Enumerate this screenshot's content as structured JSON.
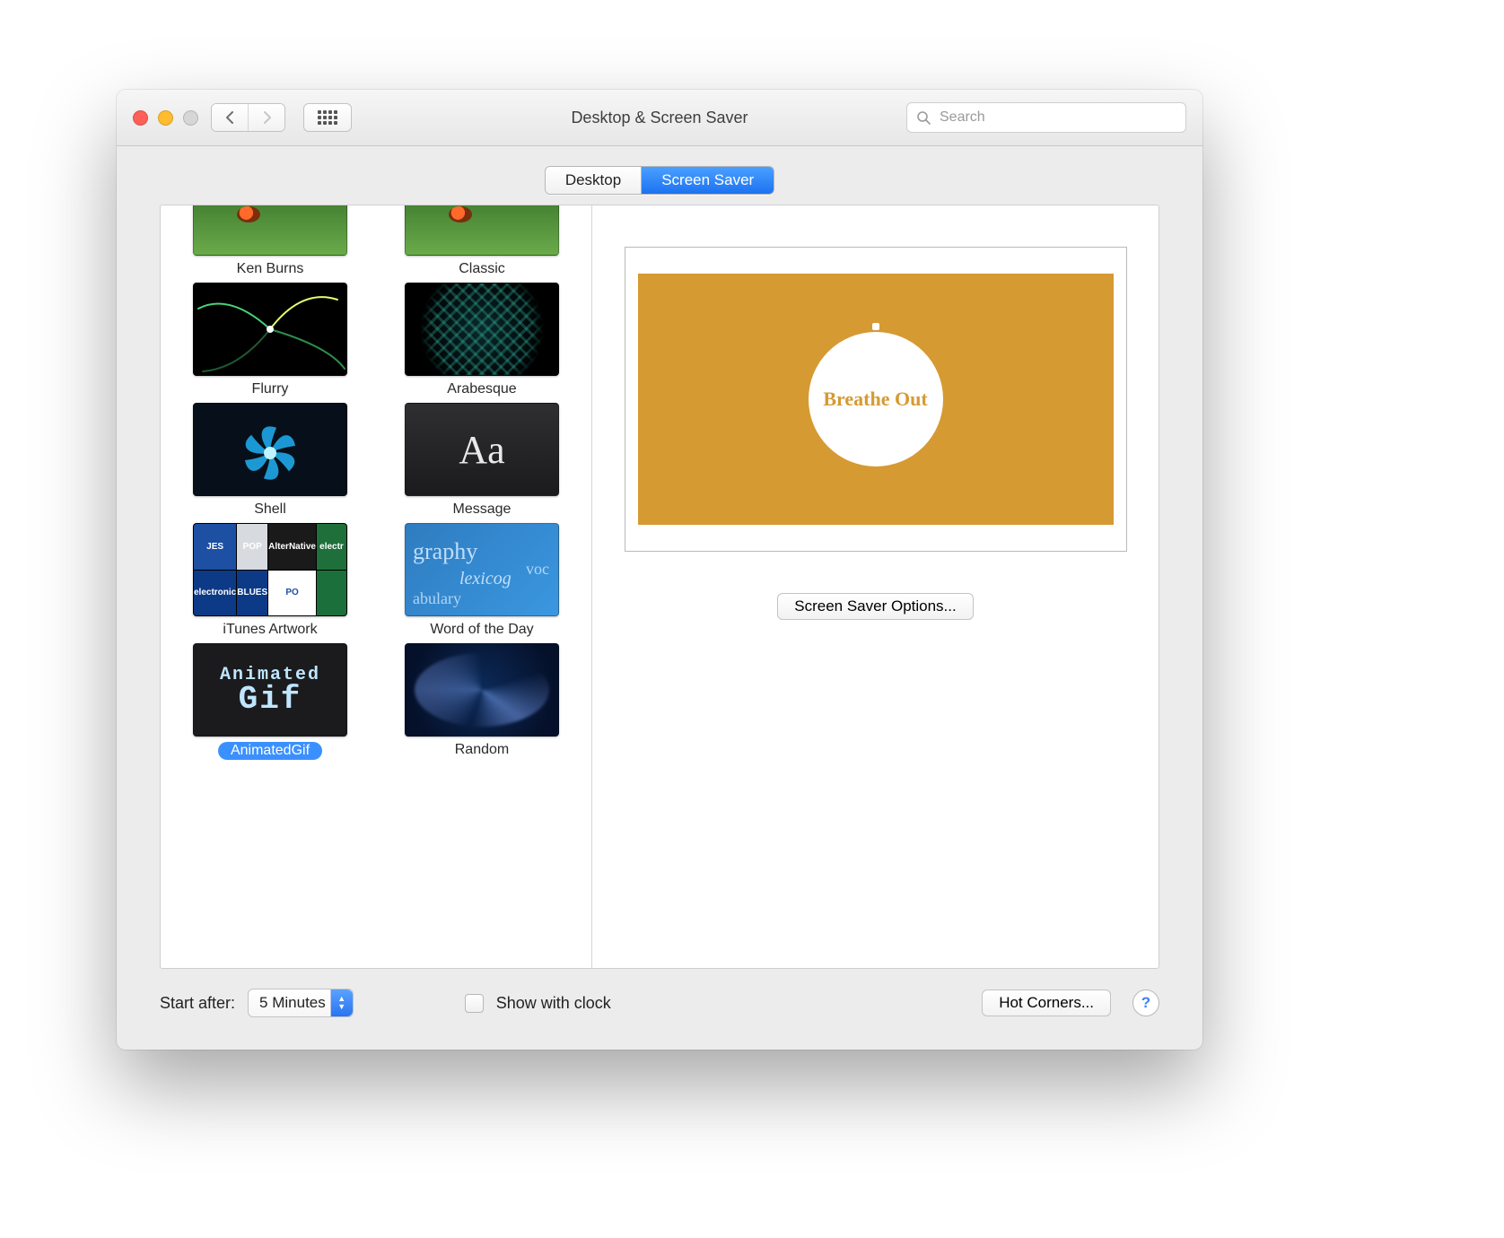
{
  "window": {
    "title": "Desktop & Screen Saver"
  },
  "search": {
    "placeholder": "Search"
  },
  "tabs": {
    "desktop": "Desktop",
    "screensaver": "Screen Saver",
    "active": "screensaver"
  },
  "screensavers": [
    {
      "id": "kenburns",
      "label": "Ken Burns"
    },
    {
      "id": "classic",
      "label": "Classic"
    },
    {
      "id": "flurry",
      "label": "Flurry"
    },
    {
      "id": "arabesque",
      "label": "Arabesque"
    },
    {
      "id": "shell",
      "label": "Shell"
    },
    {
      "id": "message",
      "label": "Message",
      "sample": "Aa"
    },
    {
      "id": "itunes",
      "label": "iTunes Artwork"
    },
    {
      "id": "wotd",
      "label": "Word of the Day",
      "words": [
        "graphy",
        "voc",
        "lexicog",
        "abulary"
      ]
    },
    {
      "id": "animgif",
      "label": "AnimatedGif",
      "line1": "Animated",
      "line2": "Gif",
      "selected": true
    },
    {
      "id": "random",
      "label": "Random"
    }
  ],
  "preview": {
    "text": "Breathe Out",
    "bg": "#d69a33"
  },
  "buttons": {
    "options": "Screen Saver Options...",
    "hotcorners": "Hot Corners..."
  },
  "bottom": {
    "start_label": "Start after:",
    "start_value": "5 Minutes",
    "show_clock": "Show with clock",
    "show_clock_checked": false
  },
  "itunes_tiles": [
    {
      "bg": "#1d4fa3",
      "txt": "JES"
    },
    {
      "bg": "#d7dbe0",
      "txt": "POP"
    },
    {
      "bg": "#1a1a1a",
      "txt": "AlterNative"
    },
    {
      "bg": "#1f6f3a",
      "txt": "electr"
    },
    {
      "bg": "#0d3a86",
      "txt": "electronic"
    },
    {
      "bg": "#0d3a86",
      "txt": "BLUES"
    },
    {
      "bg": "#ffffff",
      "txt": "PO",
      "fg": "#1d4fa3"
    },
    {
      "bg": "#1a6f3a",
      "txt": ""
    }
  ]
}
